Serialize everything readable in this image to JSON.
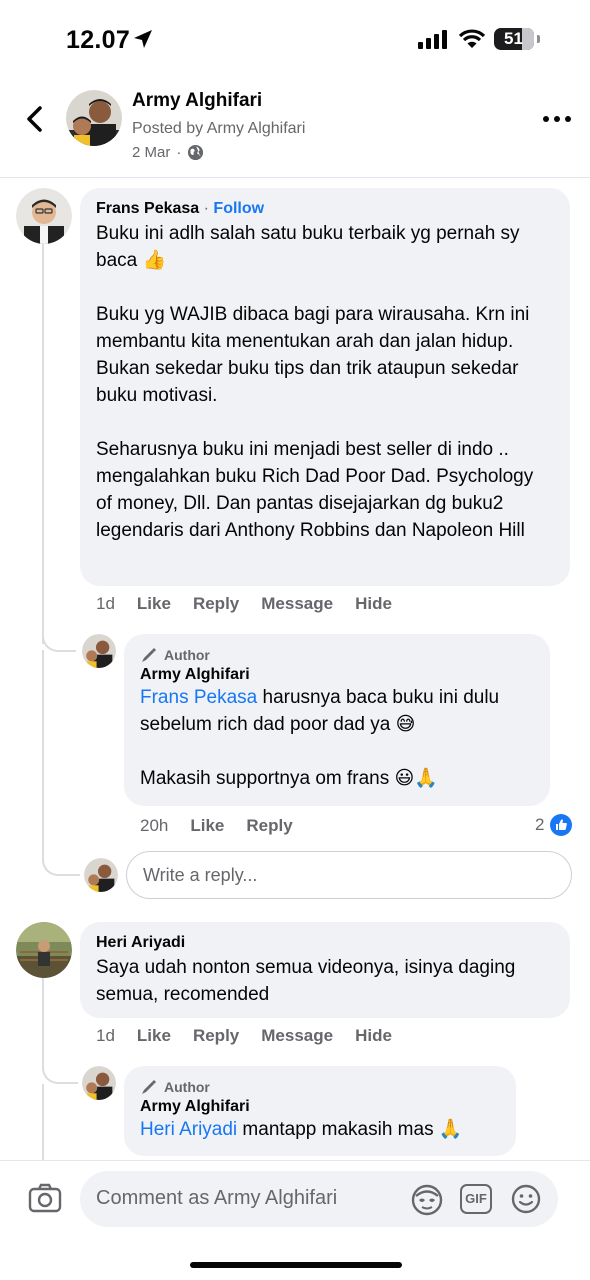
{
  "status_bar": {
    "time": "12.07",
    "battery": "51"
  },
  "header": {
    "name": "Army Alghifari",
    "posted_by": "Posted by Army Alghifari",
    "date": "2 Mar",
    "separator": "·"
  },
  "comments": [
    {
      "author": "Frans Pekasa",
      "follow_sep": "·",
      "follow_label": "Follow",
      "text": "Buku ini adlh salah satu buku terbaik yg pernah sy baca 👍\n\nBuku yg WAJIB dibaca bagi para wirausaha. Krn ini membantu kita menentukan arah dan jalan hidup. Bukan sekedar buku tips dan trik ataupun sekedar buku motivasi.\n\nSeharusnya buku ini menjadi best seller di indo .. mengalahkan buku Rich Dad Poor Dad. Psychology of money, Dll. Dan pantas disejajarkan dg buku2 legendaris dari Anthony Robbins dan Napoleon Hill",
      "time": "1d",
      "like": "Like",
      "reply": "Reply",
      "message": "Message",
      "hide": "Hide",
      "replies": [
        {
          "badge": "Author",
          "author": "Army Alghifari",
          "mention": "Frans Pekasa",
          "text": " harusnya baca buku ini dulu sebelum rich dad poor dad ya 😅\n\nMakasih supportnya om frans 😃🙏",
          "time": "20h",
          "like": "Like",
          "reply": "Reply",
          "like_count": "2"
        }
      ],
      "reply_placeholder": "Write a reply..."
    },
    {
      "author": "Heri Ariyadi",
      "text": "Saya udah nonton semua videonya, isinya daging semua, recomended",
      "time": "1d",
      "like": "Like",
      "reply": "Reply",
      "message": "Message",
      "hide": "Hide",
      "replies": [
        {
          "badge": "Author",
          "author": "Army Alghifari",
          "mention": "Heri Ariyadi",
          "text": " mantapp makasih mas 🙏"
        }
      ]
    }
  ],
  "comment_bar": {
    "placeholder": "Comment as Army Alghifari",
    "gif_label": "GIF"
  },
  "colors": {
    "link": "#1877f2",
    "bubble": "#f0f2f5",
    "secondary": "#65676b"
  }
}
